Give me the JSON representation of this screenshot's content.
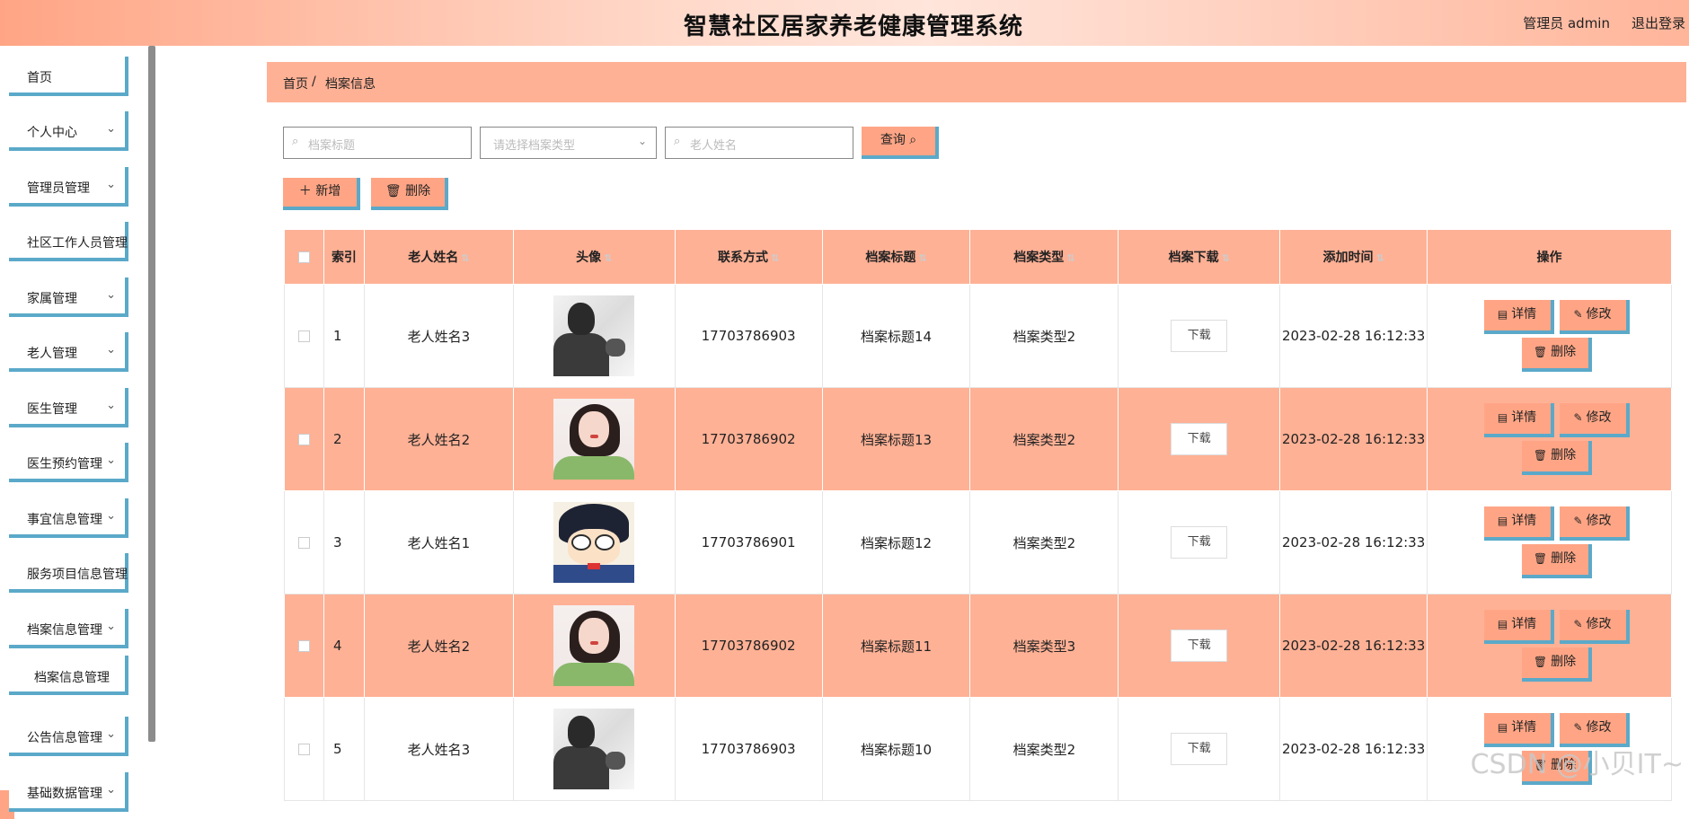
{
  "header": {
    "title": "智慧社区居家养老健康管理系统",
    "user": "管理员 admin",
    "logout": "退出登录"
  },
  "sidebar": {
    "items": [
      {
        "label": "首页",
        "chev": ""
      },
      {
        "label": "个人中心",
        "chev": "⌄"
      },
      {
        "label": "管理员管理",
        "chev": "⌄"
      },
      {
        "label": "社区工作人员管理",
        "chev": ""
      },
      {
        "label": "家属管理",
        "chev": "⌄"
      },
      {
        "label": "老人管理",
        "chev": "⌄"
      },
      {
        "label": "医生管理",
        "chev": "⌄"
      },
      {
        "label": "医生预约管理",
        "chev": "⌄"
      },
      {
        "label": "事宜信息管理",
        "chev": "⌄"
      },
      {
        "label": "服务项目信息管理",
        "chev": ""
      },
      {
        "label": "档案信息管理",
        "chev": "⌄"
      },
      {
        "label": "公告信息管理",
        "chev": "⌄"
      },
      {
        "label": "基础数据管理",
        "chev": "⌄"
      }
    ],
    "sub": {
      "label": "档案信息管理"
    }
  },
  "breadcrumb": {
    "home": "首页",
    "sep": "/",
    "current": "档案信息"
  },
  "search": {
    "title_placeholder": "档案标题",
    "type_placeholder": "请选择档案类型",
    "name_placeholder": "老人姓名",
    "query": "查询",
    "add": "新增",
    "delete": "删除"
  },
  "table": {
    "headers": [
      "",
      "索引",
      "老人姓名",
      "头像",
      "联系方式",
      "档案标题",
      "档案类型",
      "档案下载",
      "添加时间",
      "操作"
    ],
    "rows": [
      {
        "idx": "1",
        "name": "老人姓名3",
        "avatar": "dark",
        "phone": "17703786903",
        "title": "档案标题14",
        "type": "档案类型2",
        "download": "下载",
        "time": "2023-02-28 16:12:33"
      },
      {
        "idx": "2",
        "name": "老人姓名2",
        "avatar": "girl",
        "phone": "17703786902",
        "title": "档案标题13",
        "type": "档案类型2",
        "download": "下载",
        "time": "2023-02-28 16:12:33"
      },
      {
        "idx": "3",
        "name": "老人姓名1",
        "avatar": "conan",
        "phone": "17703786901",
        "title": "档案标题12",
        "type": "档案类型2",
        "download": "下载",
        "time": "2023-02-28 16:12:33"
      },
      {
        "idx": "4",
        "name": "老人姓名2",
        "avatar": "girl",
        "phone": "17703786902",
        "title": "档案标题11",
        "type": "档案类型3",
        "download": "下载",
        "time": "2023-02-28 16:12:33"
      },
      {
        "idx": "5",
        "name": "老人姓名3",
        "avatar": "dark",
        "phone": "17703786903",
        "title": "档案标题10",
        "type": "档案类型2",
        "download": "下载",
        "time": "2023-02-28 16:12:33"
      }
    ],
    "actions": {
      "detail": "详情",
      "edit": "修改",
      "delete": "删除"
    }
  },
  "watermark": "CSDN @小贝IT~",
  "colors": {
    "accent": "#ffa585",
    "row_highlight": "#ffb195",
    "border_accent": "#5ba9c9"
  }
}
